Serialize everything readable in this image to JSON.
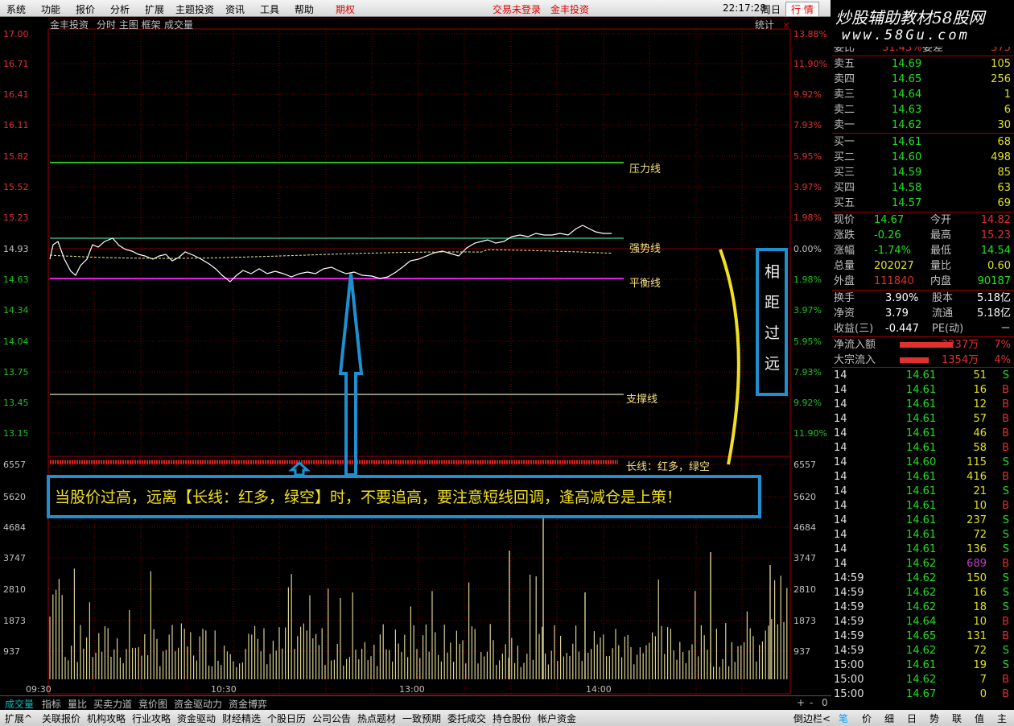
{
  "menu": {
    "items": [
      "系统",
      "功能",
      "报价",
      "分析",
      "扩展",
      "主题投资",
      "资讯",
      "工具",
      "帮助"
    ],
    "period": "期权",
    "trade": "交易未登录",
    "stock": "金丰投资",
    "time": "22:17:28",
    "weekday": "周日",
    "market": "行 情"
  },
  "logo": {
    "line1": "炒股辅助教材58股网",
    "line2": "www.58Gu.com"
  },
  "chart_header": {
    "stock": "金丰投资",
    "items": "分时 主图 框架",
    "volume": "成交量",
    "stats": "统计"
  },
  "price_axis": [
    "17.00",
    "16.71",
    "16.41",
    "16.11",
    "15.82",
    "15.52",
    "15.23",
    "14.93",
    "14.63",
    "14.34",
    "14.04",
    "13.75",
    "13.45",
    "13.15"
  ],
  "pct_axis": [
    "13.88%",
    "11.90%",
    "9.92%",
    "7.93%",
    "5.95%",
    "3.97%",
    "1.98%",
    "0.00%",
    "1.98%",
    "3.97%",
    "5.95%",
    "7.93%",
    "9.92%",
    "11.90%"
  ],
  "vol_axis": [
    "6557",
    "5620",
    "4684",
    "3747",
    "2810",
    "1873",
    "937"
  ],
  "time_axis": [
    "09:30",
    "10:30",
    "13:00",
    "14:00"
  ],
  "annotations": {
    "pressure": "压力线",
    "strong": "强势线",
    "balance": "平衡线",
    "support": "支撑线",
    "longline": "长线：红多，绿空",
    "far": [
      "相",
      "距",
      "过",
      "远"
    ],
    "note": "当股价过高，远离【长线：红多，绿空】时，不要追高，要注意短线回调，逢高减仓是上策！"
  },
  "quote_top": {
    "label1": "委比",
    "val1": "31.43%",
    "label2": "委差",
    "val2": "375"
  },
  "order_book": [
    {
      "label": "卖五",
      "price": "14.69",
      "vol": "105"
    },
    {
      "label": "卖四",
      "price": "14.65",
      "vol": "256"
    },
    {
      "label": "卖三",
      "price": "14.64",
      "vol": "1"
    },
    {
      "label": "卖二",
      "price": "14.63",
      "vol": "6"
    },
    {
      "label": "卖一",
      "price": "14.62",
      "vol": "30"
    },
    {
      "label": "买一",
      "price": "14.61",
      "vol": "68"
    },
    {
      "label": "买二",
      "price": "14.60",
      "vol": "498"
    },
    {
      "label": "买三",
      "price": "14.59",
      "vol": "85"
    },
    {
      "label": "买四",
      "price": "14.58",
      "vol": "63"
    },
    {
      "label": "买五",
      "price": "14.57",
      "vol": "69"
    }
  ],
  "stats": [
    {
      "l1": "现价",
      "v1": "14.67",
      "l2": "今开",
      "v2": "14.82"
    },
    {
      "l1": "涨跌",
      "v1": "-0.26",
      "l2": "最高",
      "v2": "15.23"
    },
    {
      "l1": "涨幅",
      "v1": "-1.74%",
      "l2": "最低",
      "v2": "14.54"
    },
    {
      "l1": "总量",
      "v1": "202027",
      "l2": "量比",
      "v2": "0.60"
    },
    {
      "l1": "外盘",
      "v1": "111840",
      "l2": "内盘",
      "v2": "90187"
    }
  ],
  "stats2": [
    {
      "l1": "换手",
      "v1": "3.90%",
      "l2": "股本",
      "v2": "5.18亿"
    },
    {
      "l1": "净资",
      "v1": "3.79",
      "l2": "流通",
      "v2": "5.18亿"
    },
    {
      "l1": "收益(三)",
      "v1": "-0.447",
      "l2": "PE(动)",
      "v2": "－"
    }
  ],
  "flows": [
    {
      "label": "净流入额",
      "val": "2237万",
      "pct": "7%"
    },
    {
      "label": "大宗流入",
      "val": "1354万",
      "pct": "4%"
    }
  ],
  "ticks": [
    {
      "t": "14",
      "p": "14.61",
      "v": "51",
      "s": "S"
    },
    {
      "t": "14",
      "p": "14.61",
      "v": "16",
      "s": "B"
    },
    {
      "t": "14",
      "p": "14.61",
      "v": "12",
      "s": "B"
    },
    {
      "t": "14",
      "p": "14.61",
      "v": "57",
      "s": "B"
    },
    {
      "t": "14",
      "p": "14.61",
      "v": "46",
      "s": "B"
    },
    {
      "t": "14",
      "p": "14.61",
      "v": "58",
      "s": "B"
    },
    {
      "t": "14",
      "p": "14.60",
      "v": "115",
      "s": "S"
    },
    {
      "t": "14",
      "p": "14.61",
      "v": "416",
      "s": "B"
    },
    {
      "t": "14",
      "p": "14.61",
      "v": "21",
      "s": "S"
    },
    {
      "t": "14",
      "p": "14.61",
      "v": "10",
      "s": "B"
    },
    {
      "t": "14",
      "p": "14.61",
      "v": "237",
      "s": "S"
    },
    {
      "t": "14",
      "p": "14.61",
      "v": "72",
      "s": "S"
    },
    {
      "t": "14",
      "p": "14.61",
      "v": "136",
      "s": "S"
    },
    {
      "t": "14",
      "p": "14.62",
      "v": "689",
      "s": "B"
    },
    {
      "t": "14:59",
      "p": "14.62",
      "v": "150",
      "s": "S"
    },
    {
      "t": "14:59",
      "p": "14.62",
      "v": "16",
      "s": "S"
    },
    {
      "t": "14:59",
      "p": "14.62",
      "v": "18",
      "s": "S"
    },
    {
      "t": "14:59",
      "p": "14.64",
      "v": "10",
      "s": "B"
    },
    {
      "t": "14:59",
      "p": "14.65",
      "v": "131",
      "s": "B"
    },
    {
      "t": "14:59",
      "p": "14.62",
      "v": "72",
      "s": "S"
    },
    {
      "t": "15:00",
      "p": "14.61",
      "v": "19",
      "s": "S"
    },
    {
      "t": "15:00",
      "p": "14.62",
      "v": "7",
      "s": "B"
    },
    {
      "t": "15:00",
      "p": "14.67",
      "v": "0",
      "s": "B"
    }
  ],
  "bottom_tabs": [
    "成交量",
    "指标",
    "量比",
    "买卖力道",
    "竞价图",
    "资金驱动力",
    "资金博弈"
  ],
  "bottom_right": [
    "+",
    "-",
    "0"
  ],
  "toolbar": [
    "扩展^",
    "关联报价",
    "机构攻略",
    "行业攻略",
    "资金驱动",
    "财经精选",
    "个股日历",
    "公司公告",
    "热点题材",
    "一致预期",
    "委托成交",
    "持仓股份",
    "帐户资金"
  ],
  "toolbar_right": "倒边栏<",
  "side_tabs": [
    "笔",
    "价",
    "细",
    "日",
    "势",
    "联",
    "值",
    "主"
  ]
}
